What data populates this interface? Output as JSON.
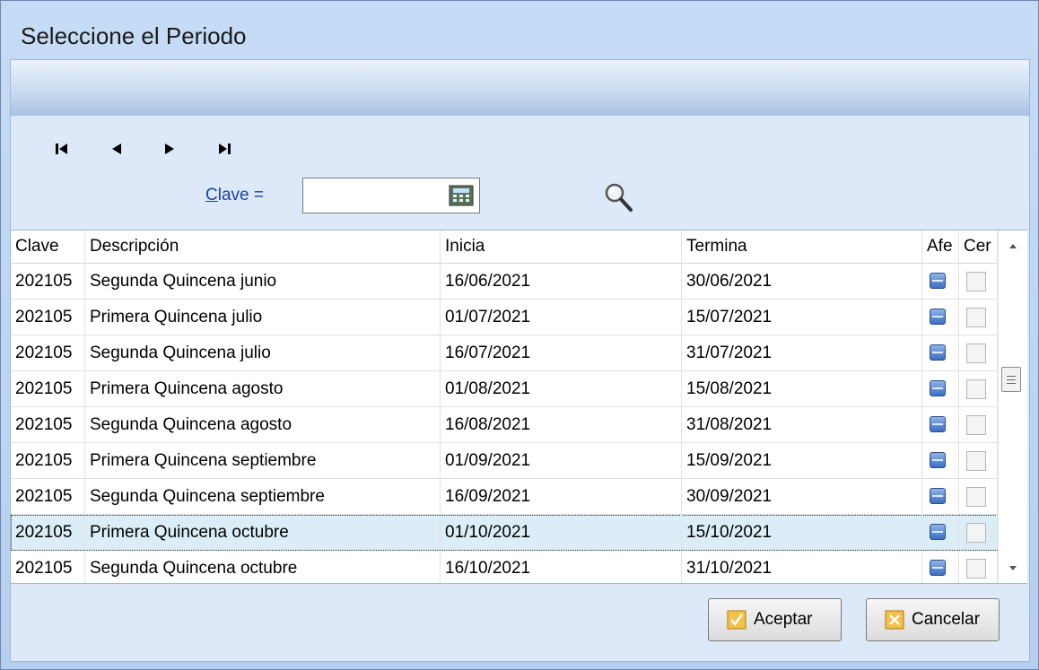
{
  "window": {
    "title": "Seleccione el Periodo"
  },
  "navigator": {
    "first": "first-record",
    "prev": "previous-record",
    "next": "next-record",
    "last": "last-record"
  },
  "filter": {
    "label_accel": "C",
    "label_rest": "lave",
    "operator": "=",
    "value": ""
  },
  "grid": {
    "columns": [
      "Clave",
      "Descripción",
      "Inicia",
      "Termina",
      "Afe",
      "Cer"
    ],
    "rows": [
      {
        "clave": "202105",
        "descripcion": "Segunda Quincena junio",
        "inicia": "16/06/2021",
        "termina": "30/06/2021",
        "afe": true,
        "cer": false
      },
      {
        "clave": "202105",
        "descripcion": "Primera Quincena julio",
        "inicia": "01/07/2021",
        "termina": "15/07/2021",
        "afe": true,
        "cer": false
      },
      {
        "clave": "202105",
        "descripcion": "Segunda Quincena julio",
        "inicia": "16/07/2021",
        "termina": "31/07/2021",
        "afe": true,
        "cer": false
      },
      {
        "clave": "202105",
        "descripcion": "Primera Quincena agosto",
        "inicia": "01/08/2021",
        "termina": "15/08/2021",
        "afe": true,
        "cer": false
      },
      {
        "clave": "202105",
        "descripcion": "Segunda Quincena agosto",
        "inicia": "16/08/2021",
        "termina": "31/08/2021",
        "afe": true,
        "cer": false
      },
      {
        "clave": "202105",
        "descripcion": "Primera Quincena septiembre",
        "inicia": "01/09/2021",
        "termina": "15/09/2021",
        "afe": true,
        "cer": false
      },
      {
        "clave": "202105",
        "descripcion": "Segunda Quincena septiembre",
        "inicia": "16/09/2021",
        "termina": "30/09/2021",
        "afe": true,
        "cer": false
      },
      {
        "clave": "202105",
        "descripcion": "Primera Quincena octubre",
        "inicia": "01/10/2021",
        "termina": "15/10/2021",
        "afe": true,
        "cer": false,
        "selected": true
      },
      {
        "clave": "202105",
        "descripcion": "Segunda Quincena octubre",
        "inicia": "16/10/2021",
        "termina": "31/10/2021",
        "afe": true,
        "cer": false
      }
    ]
  },
  "buttons": {
    "accept": "Aceptar",
    "cancel": "Cancelar"
  },
  "colors": {
    "selected_row": "#dbeef8",
    "label_link": "#1a3fb0",
    "accept_icon": "#f0b63a",
    "cancel_icon": "#f0b63a"
  }
}
